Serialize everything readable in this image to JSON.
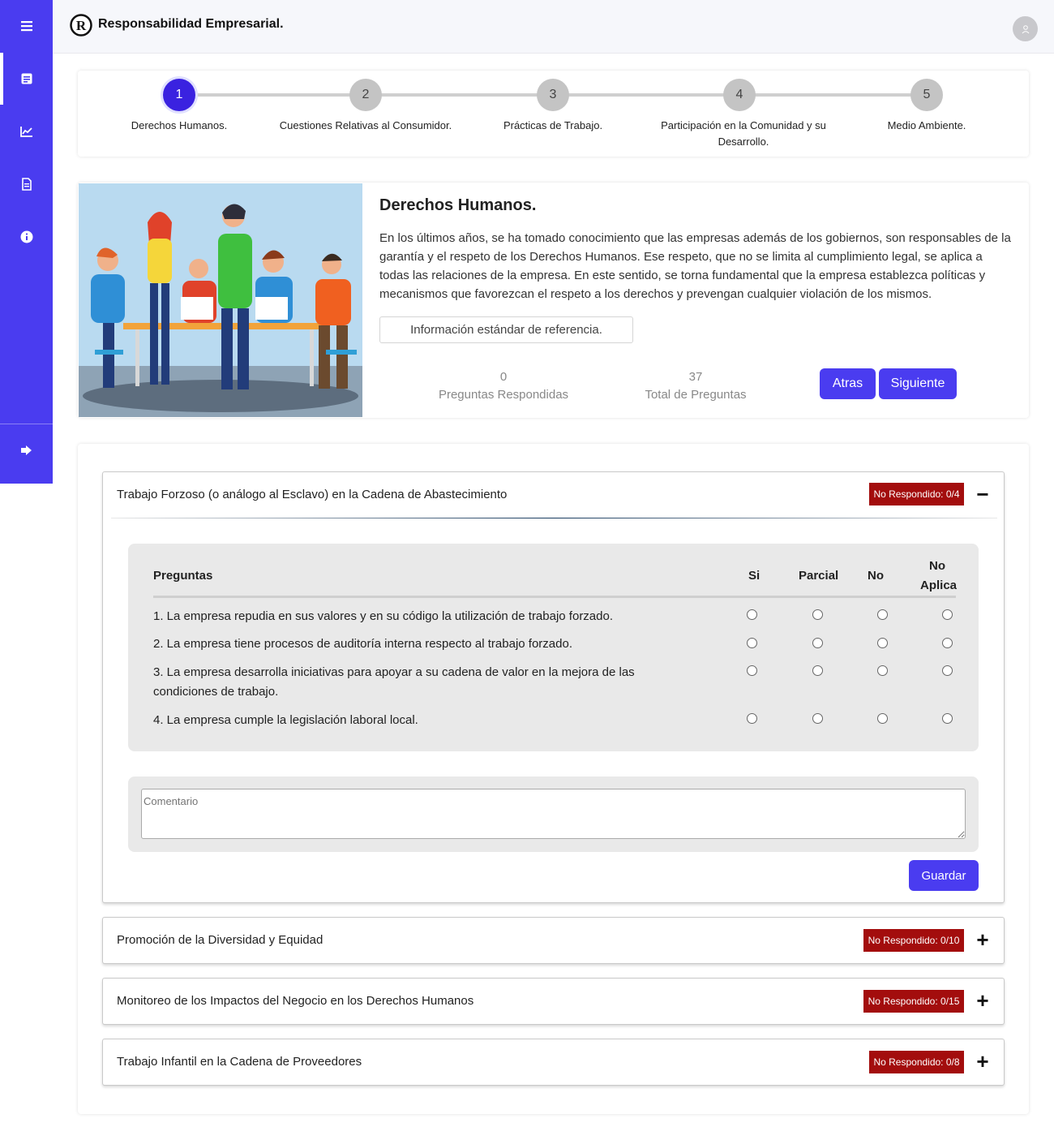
{
  "app": {
    "title": "Responsabilidad Empresarial."
  },
  "sidebar": {
    "items": [
      "menu-icon",
      "form-icon",
      "chart-icon",
      "document-icon",
      "info-icon",
      "logout-icon"
    ]
  },
  "steps": [
    {
      "number": "1",
      "label": "Derechos Humanos.",
      "active": true
    },
    {
      "number": "2",
      "label": "Cuestiones Relativas al Consumidor.",
      "active": false
    },
    {
      "number": "3",
      "label": "Prácticas de Trabajo.",
      "active": false
    },
    {
      "number": "4",
      "label": "Participación en la Comunidad y su Desarrollo.",
      "active": false
    },
    {
      "number": "5",
      "label": "Medio Ambiente.",
      "active": false
    }
  ],
  "intro": {
    "title": "Derechos Humanos.",
    "text": "En los últimos años, se ha tomado conocimiento que las empresas además de los gobiernos, son responsables de la garantía y el respeto de los Derechos Humanos. Ese respeto, que no se limita al cumplimiento legal, se aplica a todas las relaciones de la empresa. En este sentido, se torna fundamental que la empresa establezca políticas y mecanismos que favorezcan el respeto a los derechos y prevengan cualquier violación de los mismos.",
    "reference_button": "Información estándar de referencia.",
    "answered_count": "0",
    "answered_label": "Preguntas Respondidas",
    "total_count": "37",
    "total_label": "Total de Preguntas",
    "back_button": "Atras",
    "next_button": "Siguiente"
  },
  "sections": [
    {
      "title": "Trabajo Forzoso (o análogo al Esclavo) en la Cadena de Abastecimiento",
      "badge": "No Respondido: 0/4",
      "expanded": true,
      "toggle": "−",
      "table": {
        "header_question": "Preguntas",
        "header_si": "Si",
        "header_parcial": "Parcial",
        "header_no": "No",
        "header_na_1": "No",
        "header_na_2": "Aplica"
      },
      "questions": [
        "1. La empresa repudia en sus valores y en su código la utilización de trabajo forzado.",
        "2. La empresa tiene procesos de auditoría interna respecto al trabajo forzado.",
        "3. La empresa desarrolla iniciativas para apoyar a su cadena de valor en la mejora de las condiciones de trabajo.",
        "4. La empresa cumple la legislación laboral local."
      ],
      "comment_placeholder": "Comentario",
      "save_button": "Guardar"
    },
    {
      "title": "Promoción de la Diversidad y Equidad",
      "badge": "No Respondido: 0/10",
      "expanded": false,
      "toggle": "+"
    },
    {
      "title": "Monitoreo de los Impactos del Negocio en los Derechos Humanos",
      "badge": "No Respondido: 0/15",
      "expanded": false,
      "toggle": "+"
    },
    {
      "title": "Trabajo Infantil en la Cadena de Proveedores",
      "badge": "No Respondido: 0/8",
      "expanded": false,
      "toggle": "+"
    }
  ],
  "colors": {
    "primary": "#4a3cf0",
    "badge": "#a30d0d",
    "active_step": "#3a22e0"
  }
}
